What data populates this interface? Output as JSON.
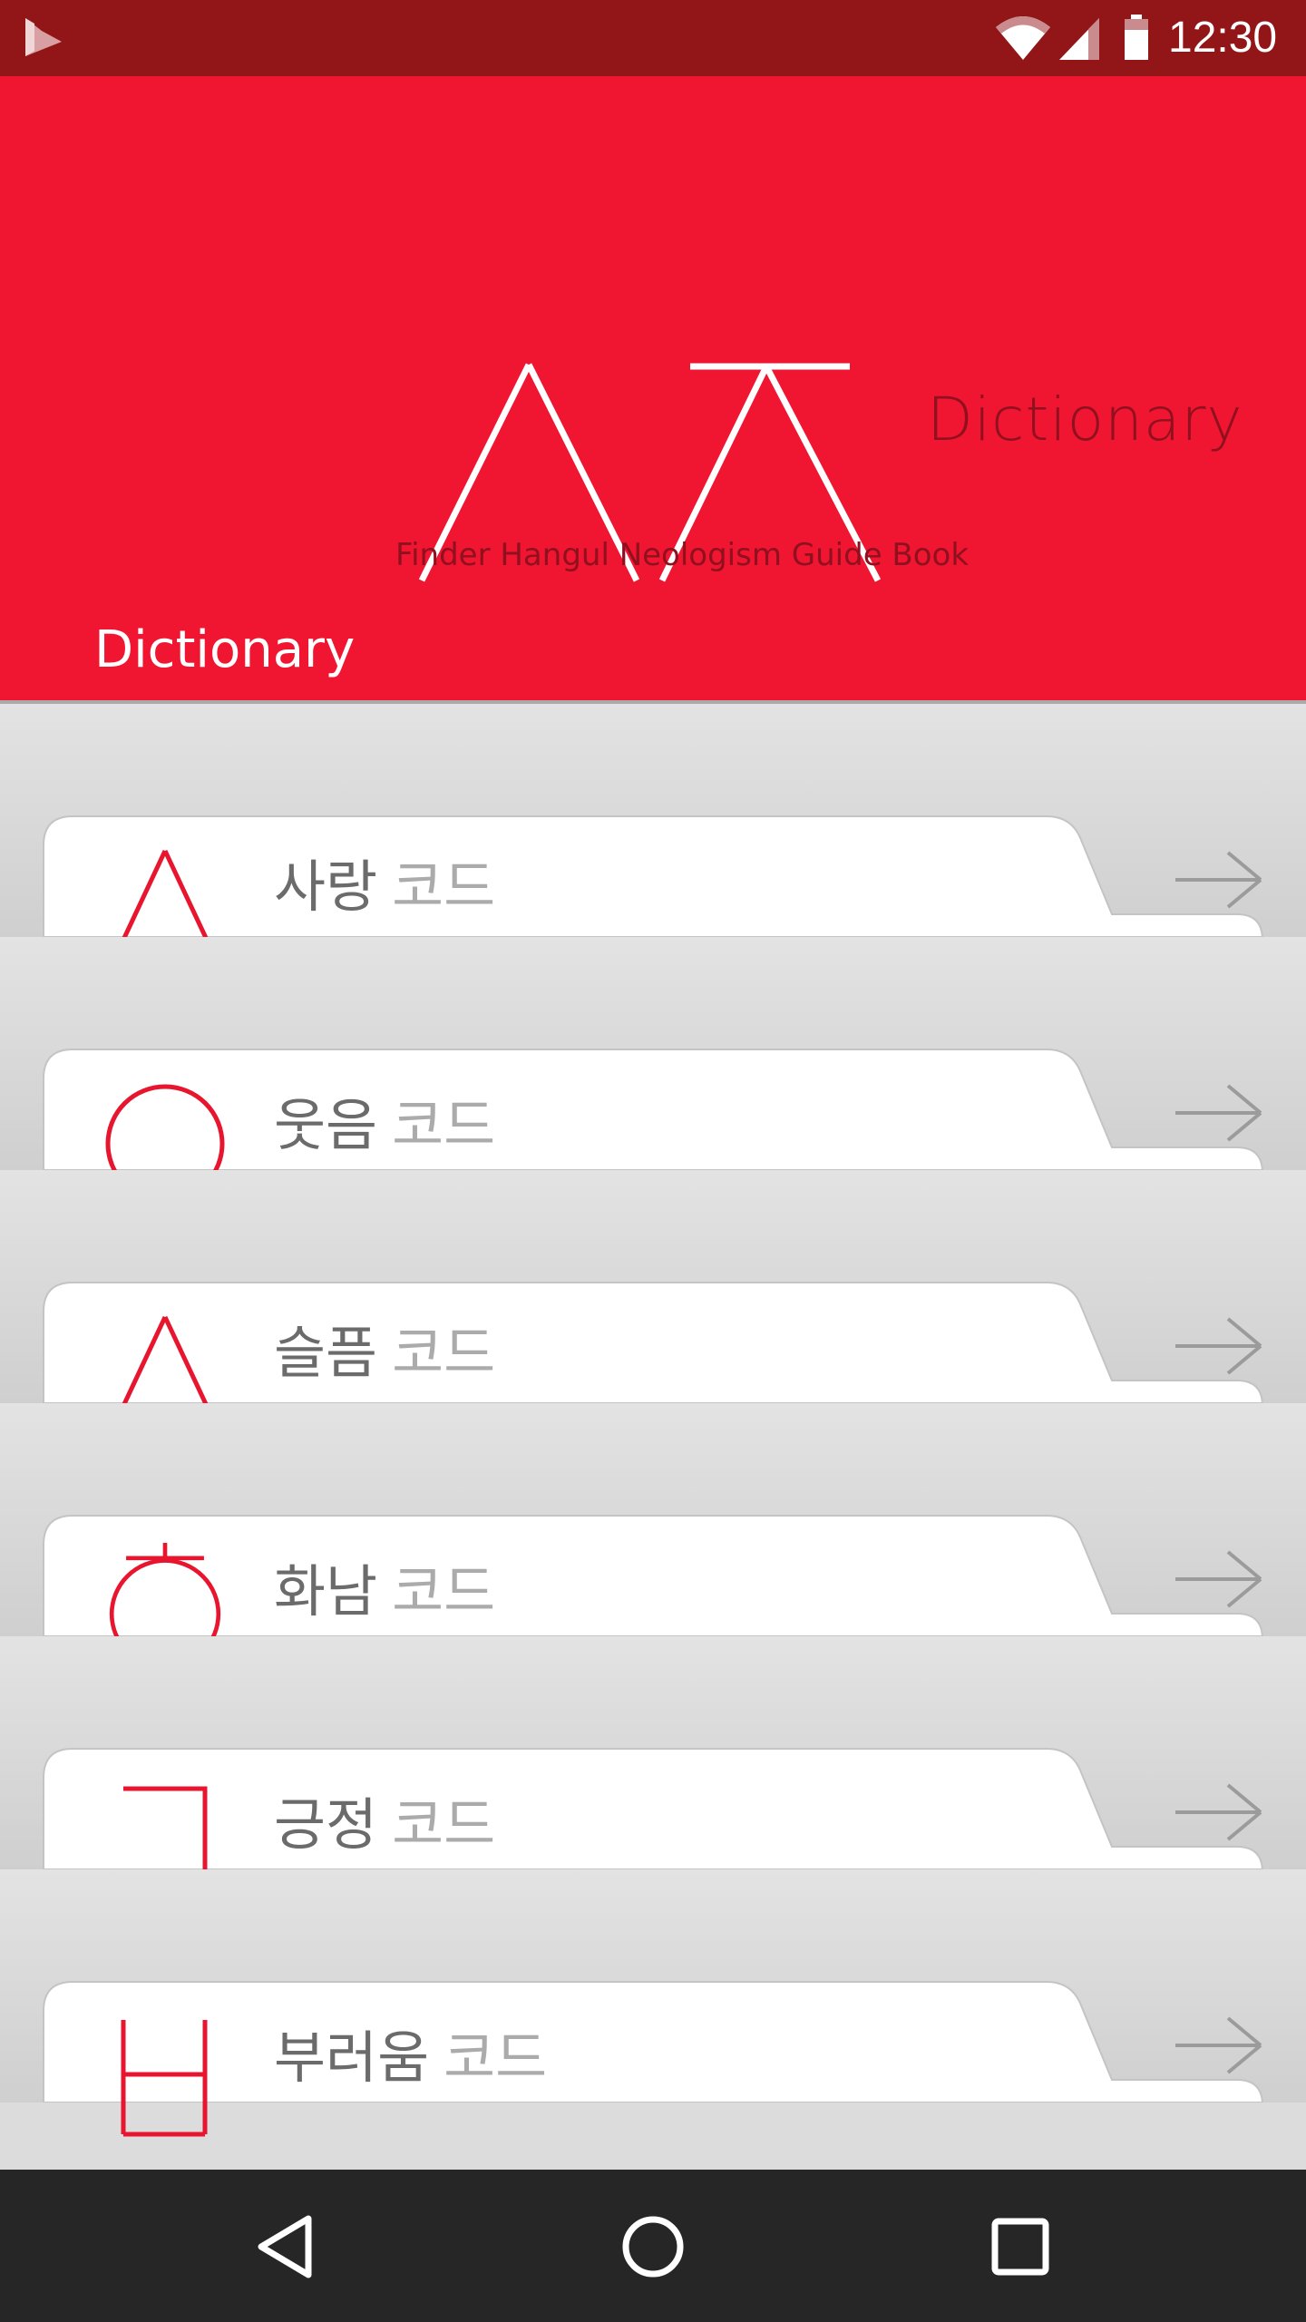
{
  "status_bar": {
    "time": "12:30",
    "icons": [
      "app-logo-icon",
      "wifi-icon",
      "cell-signal-icon",
      "battery-icon"
    ]
  },
  "header": {
    "logo_word": "Dictionary",
    "tagline": "Finder Hangul Neologism Guide Book",
    "title": "Dictionary"
  },
  "colors": {
    "status_bar": "#921618",
    "header": "#f01530",
    "accent": "#e8152f",
    "nav_bar": "#262626"
  },
  "items": [
    {
      "symbol": "siot-icon",
      "word": "사랑",
      "suffix": "코드"
    },
    {
      "symbol": "ieung-icon",
      "word": "웃음",
      "suffix": "코드"
    },
    {
      "symbol": "siot-icon",
      "word": "슬픔",
      "suffix": "코드"
    },
    {
      "symbol": "hieut-icon",
      "word": "화남",
      "suffix": "코드"
    },
    {
      "symbol": "giyeok-icon",
      "word": "긍정",
      "suffix": "코드"
    },
    {
      "symbol": "bieup-icon",
      "word": "부러움",
      "suffix": "코드"
    }
  ],
  "nav": {
    "buttons": [
      "back-icon",
      "home-icon",
      "recents-icon"
    ]
  }
}
